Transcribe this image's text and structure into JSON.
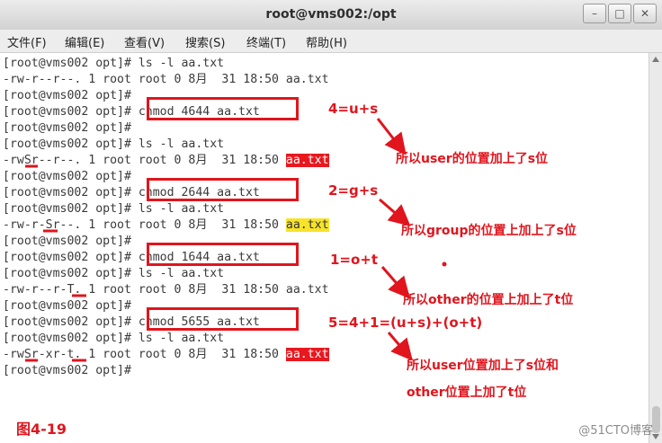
{
  "window": {
    "title": "root@vms002:/opt",
    "controls": [
      "–",
      "□",
      "✕"
    ]
  },
  "menu": [
    "文件(F)",
    "编辑(E)",
    "查看(V)",
    "搜索(S)",
    "终端(T)",
    "帮助(H)"
  ],
  "terminal": {
    "lines": [
      {
        "pre": "[root@vms002 opt]# ls -l aa.txt"
      },
      {
        "pre": "-rw-r--r--. 1 root root 0 8月  31 18:50 aa.txt"
      },
      {
        "pre": "[root@vms002 opt]#"
      },
      {
        "pre": "[root@vms002 opt]# chmod 4644 aa.txt"
      },
      {
        "pre": "[root@vms002 opt]#"
      },
      {
        "pre": "[root@vms002 opt]# ls -l aa.txt"
      },
      {
        "pre": "-rwSr--r--. 1 root root 0 8月  31 18:50 ",
        "hl": "aa.txt",
        "hl_style": "red"
      },
      {
        "pre": "[root@vms002 opt]#"
      },
      {
        "pre": "[root@vms002 opt]# chmod 2644 aa.txt"
      },
      {
        "pre": "[root@vms002 opt]# ls -l aa.txt"
      },
      {
        "pre": "-rw-r-Sr--. 1 root root 0 8月  31 18:50 ",
        "hl": "aa.txt",
        "hl_style": "yellow"
      },
      {
        "pre": "[root@vms002 opt]#"
      },
      {
        "pre": "[root@vms002 opt]# chmod 1644 aa.txt"
      },
      {
        "pre": "[root@vms002 opt]# ls -l aa.txt"
      },
      {
        "pre": "-rw-r--r-T. 1 root root 0 8月  31 18:50 aa.txt"
      },
      {
        "pre": "[root@vms002 opt]#"
      },
      {
        "pre": "[root@vms002 opt]# chmod 5655 aa.txt"
      },
      {
        "pre": "[root@vms002 opt]# ls -l aa.txt"
      },
      {
        "pre": "-rwSr-xr-t. 1 root root 0 8月  31 18:50 ",
        "hl": "aa.txt",
        "hl_style": "red"
      },
      {
        "pre": "[root@vms002 opt]#"
      }
    ]
  },
  "annotations": {
    "eq1": "4=u+s",
    "note1": "所以user的位置加上了s位",
    "eq2": "2=g+s",
    "note2": "所以group的位置上加上了s位",
    "eq3": "1=o+t",
    "note3": "所以other的位置上加上了t位",
    "eq4": "5=4+1=(u+s)+(o+t)",
    "note4a": "所以user位置加上了s位和",
    "note4b": "other位置上加了t位"
  },
  "figure_label": "图4-19",
  "watermark": "@51CTO博客",
  "colors": {
    "annotation": "#e0151d",
    "highlight_red": "#e8181f",
    "highlight_yellow": "#f7e32a"
  }
}
